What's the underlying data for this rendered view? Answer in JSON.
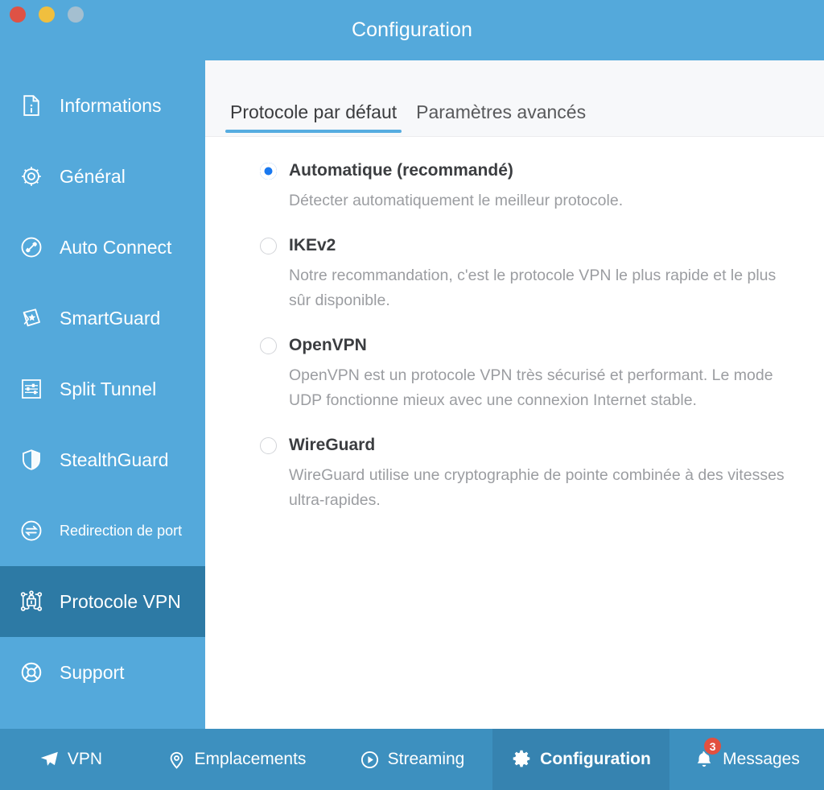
{
  "window": {
    "title": "Configuration",
    "controls": [
      {
        "name": "close",
        "color": "#de5245"
      },
      {
        "name": "minimize",
        "color": "#f0bf3e"
      },
      {
        "name": "zoom",
        "color": "#a4bfd0"
      }
    ]
  },
  "theme": {
    "sidebar_bg": "#54a9db",
    "sidebar_active_bg": "#2d7aa5",
    "bottombar_bg": "#3d90bf",
    "bottombar_active_bg": "#3683b0",
    "accent": "#56ace0",
    "radio_selected": "#1878f0",
    "badge": "#e2503f"
  },
  "sidebar": {
    "items": [
      {
        "label": "Informations",
        "icon": "info-document-icon",
        "active": false,
        "small": false
      },
      {
        "label": "Général",
        "icon": "gear-icon",
        "active": false,
        "small": false
      },
      {
        "label": "Auto Connect",
        "icon": "plug-circle-icon",
        "active": false,
        "small": false
      },
      {
        "label": "SmartGuard",
        "icon": "smartguard-shield-icon",
        "active": false,
        "small": false
      },
      {
        "label": "Split Tunnel",
        "icon": "sliders-icon",
        "active": false,
        "small": false
      },
      {
        "label": "StealthGuard",
        "icon": "shield-icon",
        "active": false,
        "small": false
      },
      {
        "label": "Redirection de port",
        "icon": "port-forward-icon",
        "active": false,
        "small": true
      },
      {
        "label": "Protocole VPN",
        "icon": "network-lock-icon",
        "active": true,
        "small": false
      },
      {
        "label": "Support",
        "icon": "lifebuoy-icon",
        "active": false,
        "small": false
      }
    ]
  },
  "main": {
    "tabs": [
      {
        "label": "Protocole par défaut",
        "active": true
      },
      {
        "label": "Paramètres avancés",
        "active": false
      }
    ],
    "protocol_options": [
      {
        "title": "Automatique (recommandé)",
        "description": "Détecter automatiquement le meilleur protocole.",
        "selected": true
      },
      {
        "title": "IKEv2",
        "description": "Notre recommandation, c'est le protocole VPN le plus rapide et le plus sûr disponible.",
        "selected": false
      },
      {
        "title": "OpenVPN",
        "description": "OpenVPN est un protocole VPN très sécurisé et performant. Le mode UDP fonctionne mieux avec une connexion Internet stable.",
        "selected": false
      },
      {
        "title": "WireGuard",
        "description": "WireGuard utilise une cryptographie de pointe combinée à des vitesses ultra-rapides.",
        "selected": false
      }
    ]
  },
  "bottom_nav": [
    {
      "label": "VPN",
      "icon": "paper-plane-icon",
      "active": false,
      "badge": null
    },
    {
      "label": "Emplacements",
      "icon": "map-pin-icon",
      "active": false,
      "badge": null
    },
    {
      "label": "Streaming",
      "icon": "play-circle-icon",
      "active": false,
      "badge": null
    },
    {
      "label": "Configuration",
      "icon": "gear-icon",
      "active": true,
      "badge": null
    },
    {
      "label": "Messages",
      "icon": "bell-icon",
      "active": false,
      "badge": "3"
    }
  ]
}
